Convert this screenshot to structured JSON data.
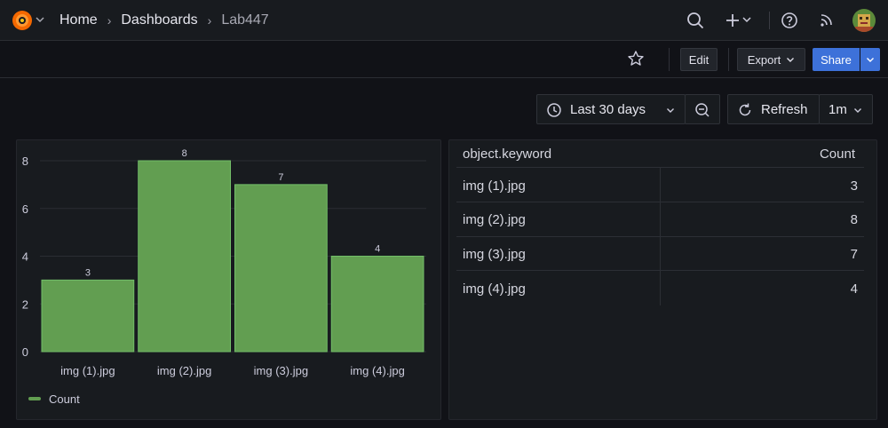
{
  "nav": {
    "breadcrumb": [
      {
        "label": "Home"
      },
      {
        "label": "Dashboards"
      },
      {
        "label": "Lab447"
      }
    ],
    "icons": [
      "search-icon",
      "plus-icon",
      "help-icon",
      "rss-icon"
    ]
  },
  "toolbar": {
    "edit_label": "Edit",
    "export_label": "Export",
    "share_label": "Share"
  },
  "time": {
    "range_label": "Last 30 days",
    "refresh_label": "Refresh",
    "interval_label": "1m"
  },
  "colors": {
    "bar": "#629e51",
    "primary": "#3d71d9"
  },
  "chart_data": {
    "type": "bar",
    "categories": [
      "img (1).jpg",
      "img (2).jpg",
      "img (3).jpg",
      "img (4).jpg"
    ],
    "series": [
      {
        "name": "Count",
        "values": [
          3,
          8,
          7,
          4
        ]
      }
    ],
    "ylim": [
      0,
      8
    ],
    "yticks": [
      "0",
      "2",
      "4",
      "6",
      "8"
    ],
    "legend": "bottom-left",
    "grid": true
  },
  "table": {
    "headers": [
      "object.keyword",
      "Count"
    ],
    "rows": [
      [
        "img (1).jpg",
        "3"
      ],
      [
        "img (2).jpg",
        "8"
      ],
      [
        "img (3).jpg",
        "7"
      ],
      [
        "img (4).jpg",
        "4"
      ]
    ]
  }
}
